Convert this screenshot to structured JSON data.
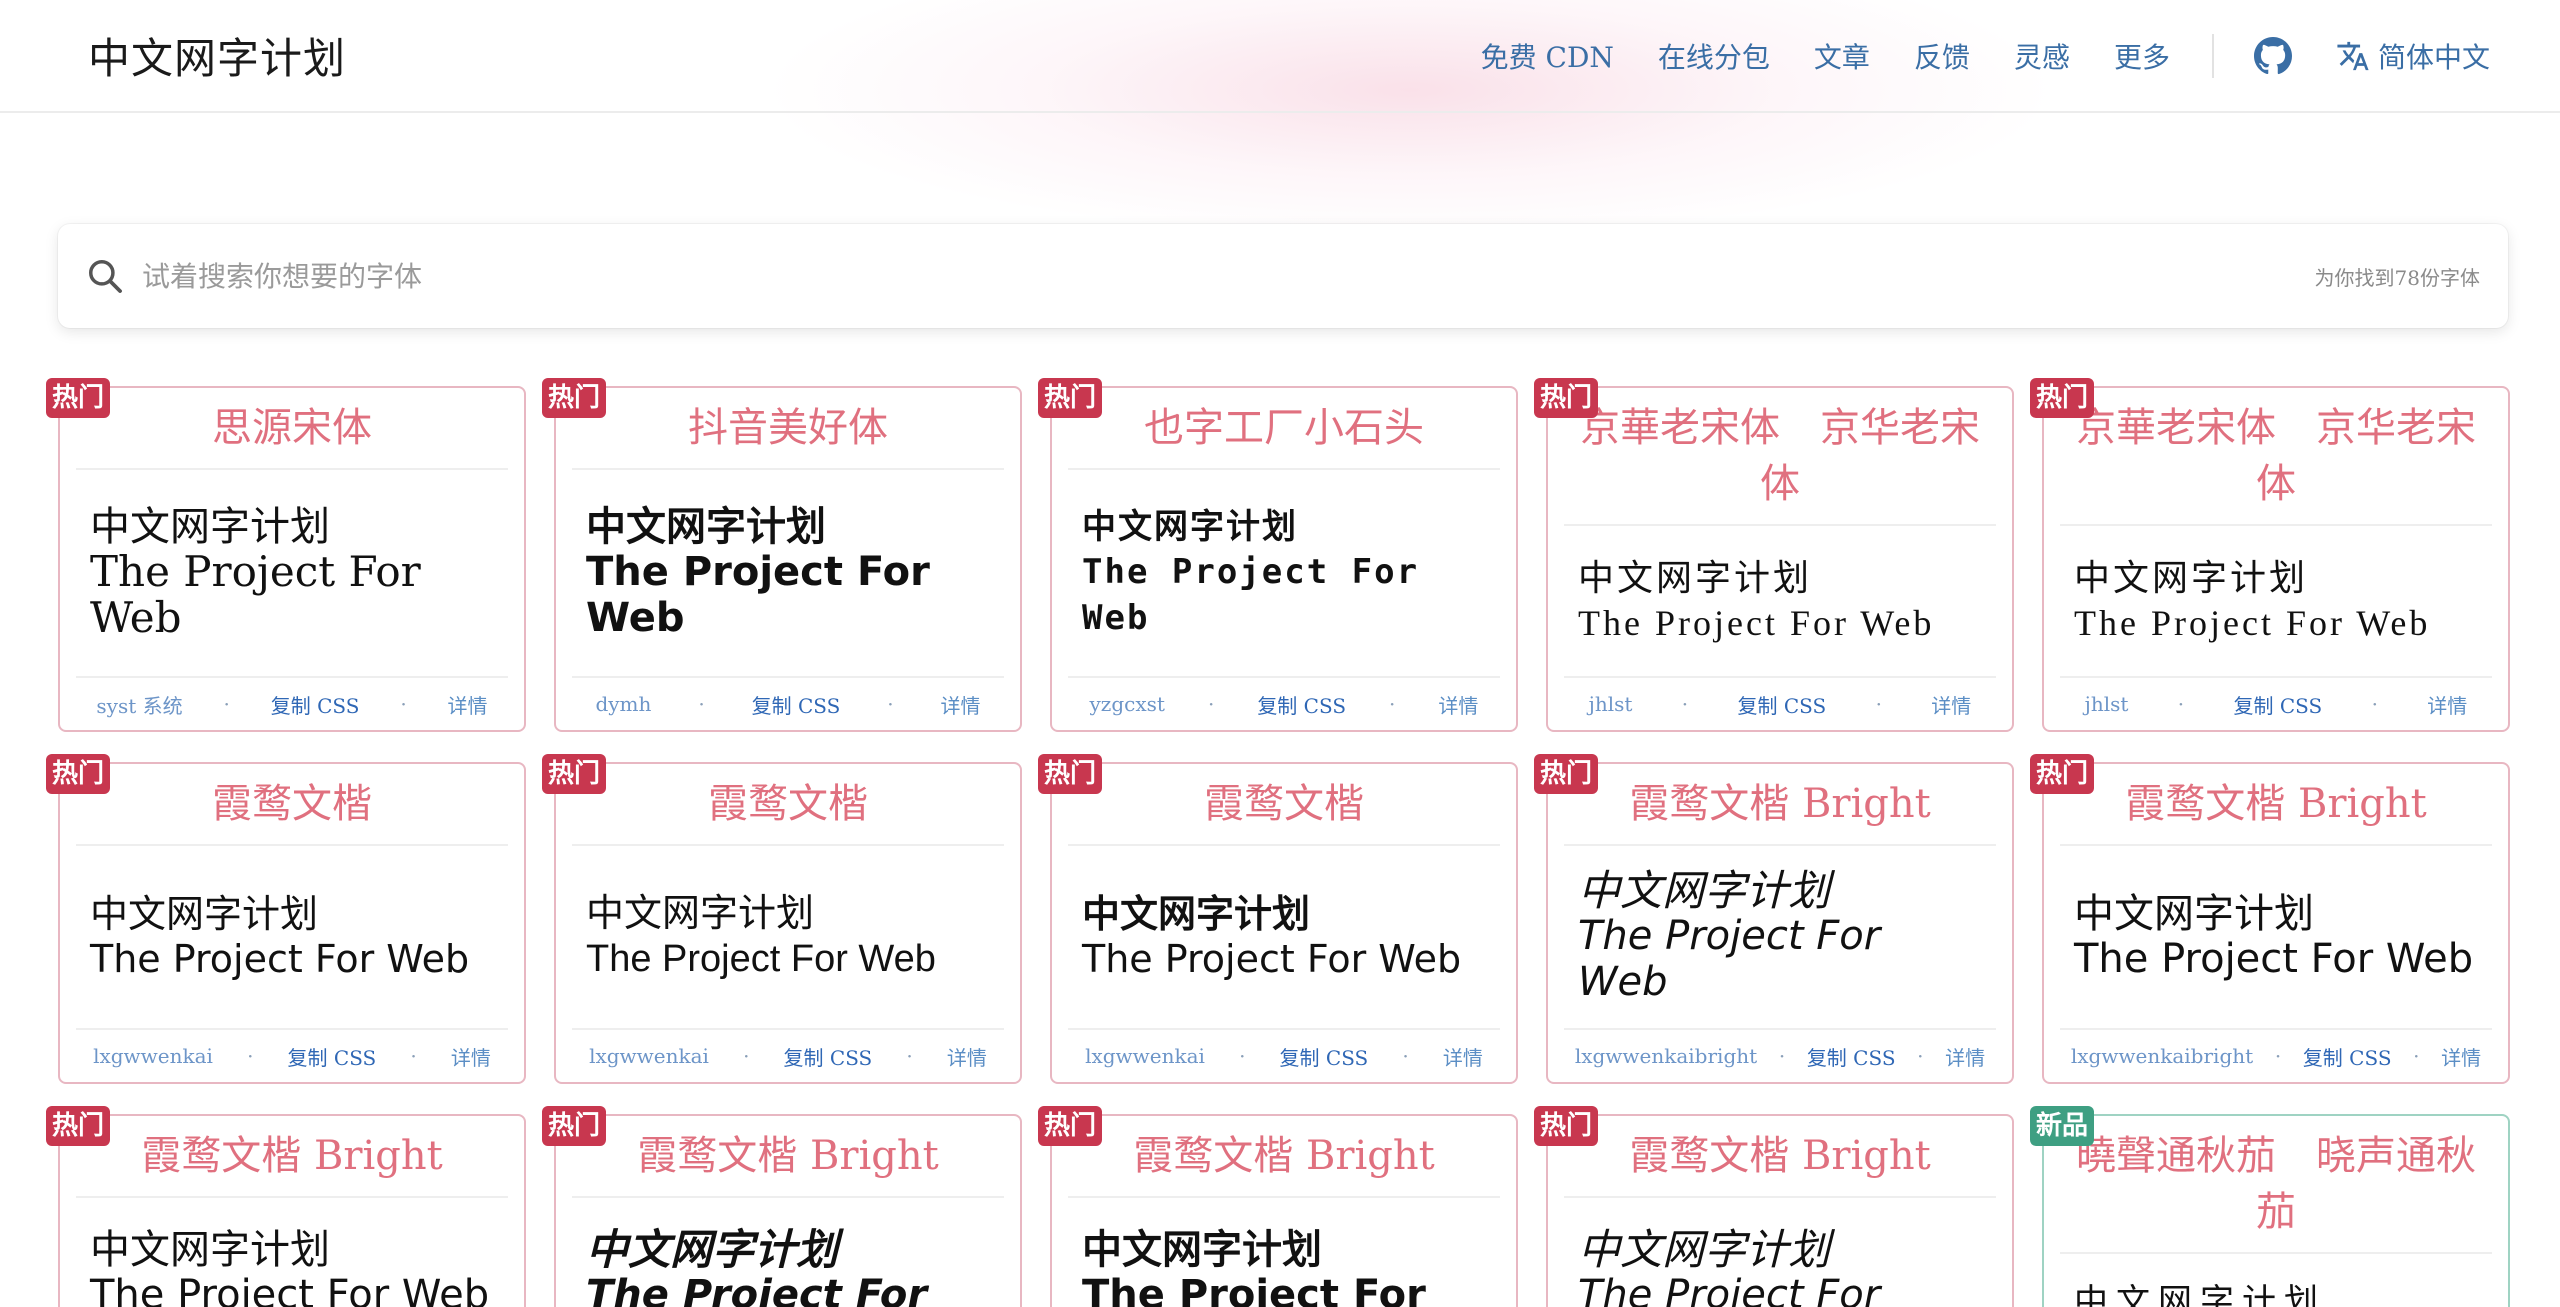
{
  "header": {
    "brand": "中文网字计划",
    "nav": [
      "免费 CDN",
      "在线分包",
      "文章",
      "反馈",
      "灵感",
      "更多"
    ],
    "language": "简体中文"
  },
  "search": {
    "placeholder": "试着搜索你想要的字体",
    "count_text": "为你找到78份字体"
  },
  "sample": {
    "zh": "中文网字计划",
    "en": "The Project For Web"
  },
  "cards": [
    {
      "badge": "热门",
      "title": "思源宋体",
      "slug": "syst  系统",
      "copy": "复制 CSS",
      "detail": "详情"
    },
    {
      "badge": "热门",
      "title": "抖音美好体",
      "slug": "dymh",
      "copy": "复制 CSS",
      "detail": "详情"
    },
    {
      "badge": "热门",
      "title": "也字工厂小石头",
      "slug": "yzgcxst",
      "copy": "复制 CSS",
      "detail": "详情"
    },
    {
      "badge": "热门",
      "title": "京華老宋体　京华老宋体",
      "slug": "jhlst",
      "copy": "复制 CSS",
      "detail": "详情"
    },
    {
      "badge": "热门",
      "title": "京華老宋体　京华老宋体",
      "slug": "jhlst",
      "copy": "复制 CSS",
      "detail": "详情"
    },
    {
      "badge": "热门",
      "title": "霞鹜文楷",
      "slug": "lxgwwenkai",
      "copy": "复制 CSS",
      "detail": "详情"
    },
    {
      "badge": "热门",
      "title": "霞鹜文楷",
      "slug": "lxgwwenkai",
      "copy": "复制 CSS",
      "detail": "详情"
    },
    {
      "badge": "热门",
      "title": "霞鹜文楷",
      "slug": "lxgwwenkai",
      "copy": "复制 CSS",
      "detail": "详情"
    },
    {
      "badge": "热门",
      "title": "霞鹜文楷 Bright",
      "slug": "lxgwwenkaibright",
      "copy": "复制 CSS",
      "detail": "详情"
    },
    {
      "badge": "热门",
      "title": "霞鹜文楷 Bright",
      "slug": "lxgwwenkaibright",
      "copy": "复制 CSS",
      "detail": "详情"
    },
    {
      "badge": "热门",
      "title": "霞鹜文楷 Bright",
      "slug": "",
      "copy": "",
      "detail": ""
    },
    {
      "badge": "热门",
      "title": "霞鹜文楷 Bright",
      "slug": "",
      "copy": "",
      "detail": ""
    },
    {
      "badge": "热门",
      "title": "霞鹜文楷 Bright",
      "slug": "",
      "copy": "",
      "detail": ""
    },
    {
      "badge": "热门",
      "title": "霞鹜文楷 Bright",
      "slug": "",
      "copy": "",
      "detail": ""
    },
    {
      "badge": "新品",
      "title": "曉聲通秋茄　晓声通秋茄",
      "slug": "",
      "copy": "",
      "detail": ""
    }
  ],
  "colors": {
    "accent_link": "#3a6ea5",
    "title_pink": "#e0707f",
    "hot_badge": "#c8374f",
    "new_badge": "#3e9f82"
  }
}
